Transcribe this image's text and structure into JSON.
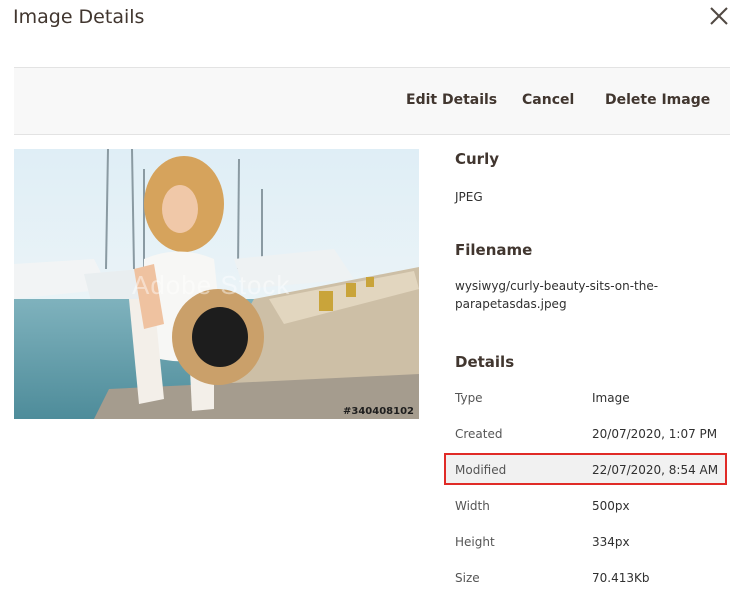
{
  "modal": {
    "title": "Image Details"
  },
  "toolbar": {
    "edit_label": "Edit Details",
    "cancel_label": "Cancel",
    "delete_label": "Delete Image"
  },
  "image": {
    "id_label": "#340408102",
    "watermark": "Adobe Stock"
  },
  "info": {
    "name": "Curly",
    "format": "JPEG",
    "filename_heading": "Filename",
    "filename": "wysiwyg/curly-beauty-sits-on-the-parapetasdas.jpeg",
    "details_heading": "Details",
    "rows": [
      {
        "label": "Type",
        "value": "Image"
      },
      {
        "label": "Created",
        "value": "20/07/2020, 1:07 PM"
      },
      {
        "label": "Modified",
        "value": "22/07/2020, 8:54 AM"
      },
      {
        "label": "Width",
        "value": "500px"
      },
      {
        "label": "Height",
        "value": "334px"
      },
      {
        "label": "Size",
        "value": "70.413Kb"
      }
    ]
  },
  "colors": {
    "highlight_border": "#e02b27",
    "toolbar_bg": "#f8f8f8"
  },
  "icons": {
    "close": "close-icon"
  }
}
